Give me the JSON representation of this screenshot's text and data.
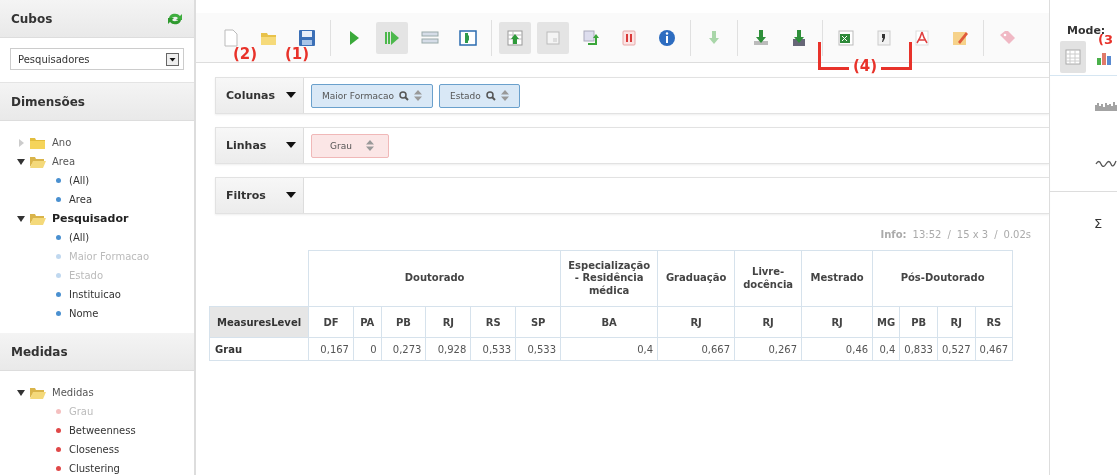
{
  "sidebar": {
    "cubes": {
      "title": "Cubos",
      "selected_cube": "Pesquisadores"
    },
    "dimensions": {
      "title": "Dimensões",
      "tree": [
        {
          "label": "Ano",
          "expanded": false,
          "selected": false
        },
        {
          "label": "Area",
          "expanded": true,
          "selected": false,
          "children": [
            {
              "label": "(All)",
              "disabled": false
            },
            {
              "label": "Area",
              "disabled": false
            }
          ]
        },
        {
          "label": "Pesquisador",
          "expanded": true,
          "selected": true,
          "children": [
            {
              "label": "(All)",
              "disabled": false
            },
            {
              "label": "Maior Formacao",
              "disabled": true
            },
            {
              "label": "Estado",
              "disabled": true
            },
            {
              "label": "Instituicao",
              "disabled": false
            },
            {
              "label": "Nome",
              "disabled": false
            }
          ]
        }
      ]
    },
    "measures": {
      "title": "Medidas",
      "tree": [
        {
          "label": "Medidas",
          "expanded": true,
          "selected": false,
          "children": [
            {
              "label": "Grau",
              "disabled": true
            },
            {
              "label": "Betweenness",
              "disabled": false
            },
            {
              "label": "Closeness",
              "disabled": false
            },
            {
              "label": "Clustering",
              "disabled": false
            }
          ]
        }
      ]
    }
  },
  "toolbar": {
    "groups": [
      [
        {
          "kind": "new",
          "pressed": false
        },
        {
          "kind": "open",
          "pressed": false
        },
        {
          "kind": "save",
          "pressed": false
        }
      ],
      [
        {
          "kind": "play",
          "pressed": false
        },
        {
          "kind": "play-all",
          "pressed": true
        },
        {
          "kind": "fields",
          "pressed": false
        },
        {
          "kind": "panel",
          "pressed": false
        }
      ],
      [
        {
          "kind": "table-up",
          "pressed": true
        },
        {
          "kind": "blank",
          "pressed": true
        },
        {
          "kind": "swap",
          "pressed": false
        },
        {
          "kind": "pause",
          "pressed": false
        },
        {
          "kind": "info",
          "pressed": false
        }
      ],
      [
        {
          "kind": "down-light",
          "pressed": false
        }
      ],
      [
        {
          "kind": "down",
          "pressed": false
        },
        {
          "kind": "down-doc",
          "pressed": false
        }
      ],
      [
        {
          "kind": "excel",
          "pressed": false
        },
        {
          "kind": "doc",
          "pressed": false
        },
        {
          "kind": "pdf",
          "pressed": false
        },
        {
          "kind": "edit",
          "pressed": false
        }
      ],
      [
        {
          "kind": "tag",
          "pressed": false
        }
      ]
    ]
  },
  "drop_zones": [
    {
      "label": "Colunas",
      "kind": "columns",
      "chips": [
        {
          "label": "Maior Formacao",
          "filter": true
        },
        {
          "label": "Estado",
          "filter": true
        }
      ]
    },
    {
      "label": "Linhas",
      "kind": "rows",
      "chips": [
        {
          "label": "Grau",
          "filter": false
        }
      ]
    },
    {
      "label": "Filtros",
      "kind": "filters"
    }
  ],
  "info": {
    "label": "Info:",
    "time": "13:52",
    "separator_1": "/",
    "size": "15 x 3",
    "separator_2": "/",
    "duration": "0.02s"
  },
  "table": {
    "row_header": "MeasuresLevel",
    "column_groups": [
      {
        "label": "Doutorado",
        "columns": [
          "DF",
          "PA",
          "PB",
          "RJ",
          "RS",
          "SP"
        ]
      },
      {
        "label": "Especialização - Residência médica",
        "columns": [
          "BA"
        ]
      },
      {
        "label": "Graduação",
        "columns": [
          "RJ"
        ]
      },
      {
        "label": "Livre-docência",
        "columns": [
          "RJ"
        ]
      },
      {
        "label": "Mestrado",
        "columns": [
          "RJ"
        ]
      },
      {
        "label": "Pós-Doutorado",
        "columns": [
          "MG",
          "PB",
          "RJ",
          "RS"
        ]
      }
    ],
    "rows": [
      {
        "label": "Grau",
        "values": [
          "0,167",
          "0",
          "0,273",
          "0,928",
          "0,533",
          "0,533",
          "0,4",
          "0,667",
          "0,267",
          "0,46",
          "0,4",
          "0,833",
          "0,527",
          "0,467"
        ]
      }
    ]
  },
  "mode_panel": {
    "title": "Mode:",
    "modes": [
      {
        "kind": "table",
        "selected": true
      },
      {
        "kind": "chart",
        "selected": false
      }
    ],
    "sigma": "Σ"
  },
  "annotations": [
    {
      "text": "(2)",
      "kind": "plain"
    },
    {
      "text": "(1)",
      "kind": "plain"
    },
    {
      "text": "(4)",
      "kind": "bracket"
    },
    {
      "text": "(3",
      "kind": "plain"
    }
  ]
}
